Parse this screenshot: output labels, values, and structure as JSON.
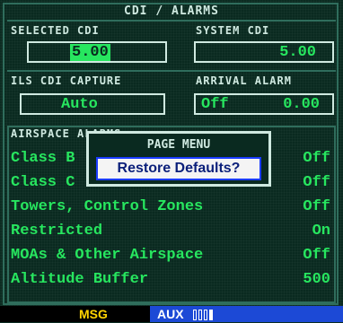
{
  "page": {
    "title": "CDI / ALARMS"
  },
  "selected_cdi": {
    "label": "SELECTED CDI",
    "value": "5.00"
  },
  "system_cdi": {
    "label": "SYSTEM CDI",
    "value": "5.00"
  },
  "ils_capture": {
    "label": "ILS CDI CAPTURE",
    "value": "Auto"
  },
  "arrival_alarm": {
    "label": "ARRIVAL ALARM",
    "status": "Off",
    "value": "0.00"
  },
  "airspace": {
    "label": "AIRSPACE ALARMS",
    "items": [
      {
        "name": "Class B",
        "value": "Off"
      },
      {
        "name": "Class C",
        "value": "Off"
      },
      {
        "name": "Towers, Control Zones",
        "value": "Off"
      },
      {
        "name": "Restricted",
        "value": "On"
      },
      {
        "name": "MOAs & Other Airspace",
        "value": "Off"
      },
      {
        "name": "Altitude Buffer",
        "value": "500"
      }
    ]
  },
  "page_menu": {
    "title": "PAGE MENU",
    "item": "Restore Defaults?"
  },
  "status_bar": {
    "msg": "MSG",
    "group": "AUX",
    "pages_total": 4,
    "page_active": 4
  },
  "colors": {
    "accent": "#27e65f",
    "label": "#cfe9e0",
    "background": "#0a2a20",
    "status_blue": "#1c49d6",
    "msg_yellow": "#ffd400"
  }
}
